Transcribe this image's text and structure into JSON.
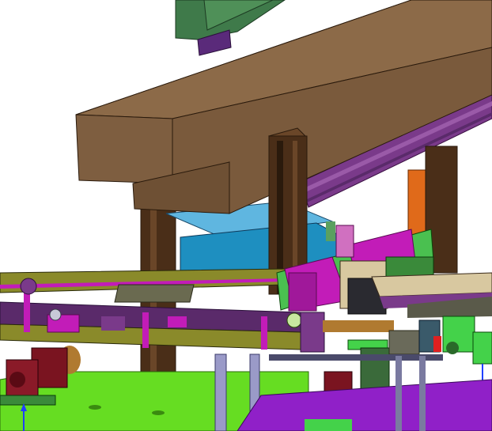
{
  "viewport": {
    "background": "#ffffff",
    "colors": {
      "beam_front": "#7a5a3c",
      "beam_top": "#8c6a48",
      "beam_side": "#5e4329",
      "column": "#4a2e18",
      "column_edge": "#2a1a0c",
      "monitor_green": "#3f7a4a",
      "rail_purple": "#7a3a8a",
      "plate_blue": "#1e8fc0",
      "plate_blue_light": "#5fb6e0",
      "magenta": "#c21cb8",
      "bright_green": "#44d24a",
      "lime_floor": "#66dd22",
      "olive": "#8a8a2a",
      "orange": "#e06a1a",
      "motor_red": "#7a1420",
      "gray_rod": "#9a9ac8",
      "axis_blue": "#2040ff"
    }
  }
}
